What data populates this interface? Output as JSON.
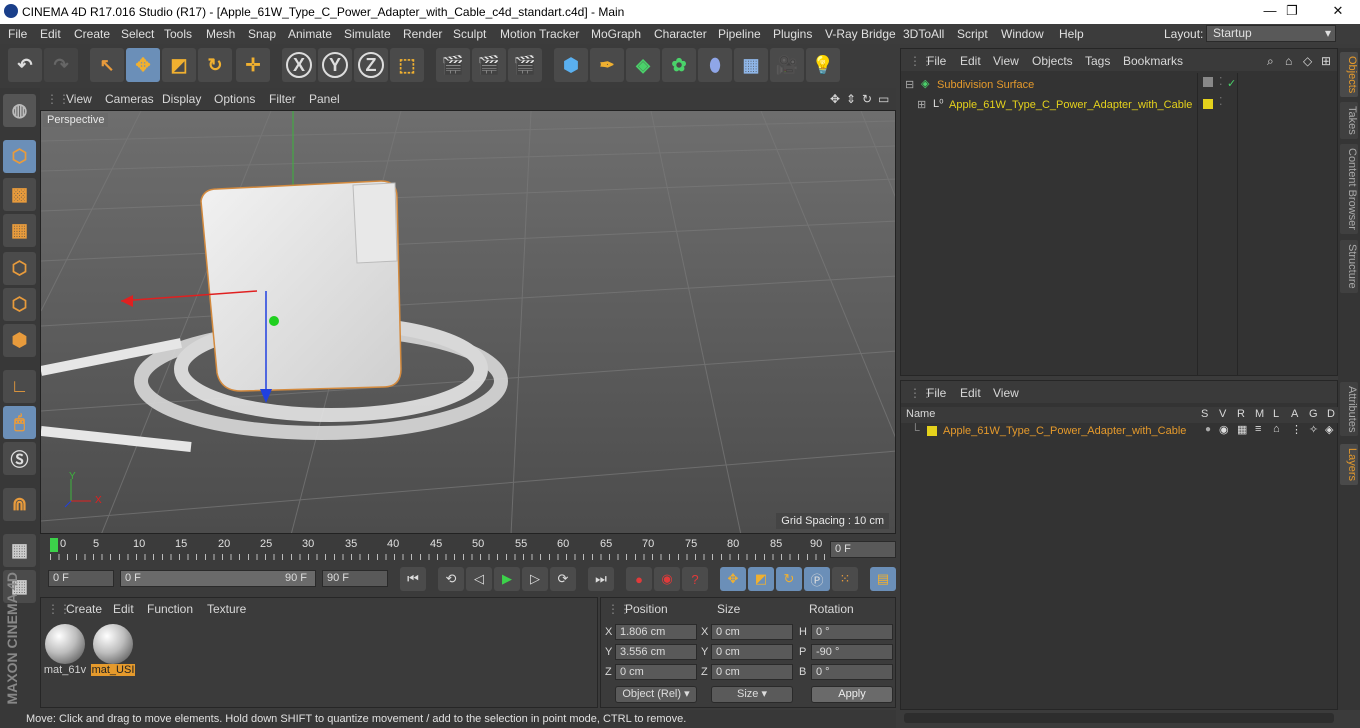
{
  "window": {
    "title": "CINEMA 4D R17.016 Studio (R17) - [Apple_61W_Type_C_Power_Adapter_with_Cable_c4d_standart.c4d] - Main",
    "minimize": "—",
    "maximize": "❐",
    "close": "✕"
  },
  "menu": [
    "File",
    "Edit",
    "Create",
    "Select",
    "Tools",
    "Mesh",
    "Snap",
    "Animate",
    "Simulate",
    "Render",
    "Sculpt",
    "Motion Tracker",
    "MoGraph",
    "Character",
    "Pipeline",
    "Plugins",
    "V-Ray Bridge",
    "3DToAll",
    "Script",
    "Window",
    "Help"
  ],
  "layout": {
    "label": "Layout:",
    "value": "Startup"
  },
  "toolbar": {
    "x": "X",
    "y": "Y",
    "z": "Z"
  },
  "viewport": {
    "menu": [
      "View",
      "Cameras",
      "Display",
      "Options",
      "Filter",
      "Panel"
    ],
    "camera": "Perspective",
    "grid_spacing": "Grid Spacing : 10 cm",
    "axis_y": "Y",
    "axis_x": "X"
  },
  "timeline": {
    "ticks": [
      "0",
      "5",
      "10",
      "15",
      "20",
      "25",
      "30",
      "35",
      "40",
      "45",
      "50",
      "55",
      "60",
      "65",
      "70",
      "75",
      "80",
      "85",
      "90"
    ],
    "current_frame": "0 F",
    "start": "0 F",
    "range_start": "0 F",
    "range_end": "90 F",
    "end": "90 F"
  },
  "materials": {
    "menu": [
      "Create",
      "Edit",
      "Function",
      "Texture"
    ],
    "items": [
      "mat_61v",
      "mat_USI"
    ]
  },
  "coords": {
    "headers": [
      "Position",
      "Size",
      "Rotation"
    ],
    "pos": {
      "x": "1.806 cm",
      "y": "3.556 cm",
      "z": "0 cm"
    },
    "size": {
      "x": "0 cm",
      "y": "0 cm",
      "z": "0 cm"
    },
    "rot": {
      "h": "0 °",
      "p": "-90 °",
      "b": "0 °"
    },
    "labels": {
      "x": "X",
      "y": "Y",
      "z": "Z",
      "h": "H",
      "p": "P",
      "b": "B"
    },
    "mode": "Object (Rel)",
    "size_mode": "Size",
    "apply": "Apply"
  },
  "status": "Move: Click and drag to move elements. Hold down SHIFT to quantize movement / add to the selection in point mode, CTRL to remove.",
  "objects": {
    "menu": [
      "File",
      "Edit",
      "View",
      "Objects",
      "Tags",
      "Bookmarks"
    ],
    "rows": [
      "Subdivision Surface",
      "Apple_61W_Type_C_Power_Adapter_with_Cable"
    ]
  },
  "layers": {
    "menu": [
      "File",
      "Edit",
      "View"
    ],
    "columns": [
      "Name",
      "S",
      "V",
      "R",
      "M",
      "L",
      "A",
      "G",
      "D"
    ],
    "row": "Apple_61W_Type_C_Power_Adapter_with_Cable"
  },
  "side_tabs": [
    "Objects",
    "Takes",
    "Content Browser",
    "Structure",
    "Attributes",
    "Layers"
  ],
  "brand": "MAXON CINEMA 4D",
  "colors": {
    "accent": "#e59a2c",
    "active": "#6b8fb8",
    "layer": "#e5d21c"
  }
}
